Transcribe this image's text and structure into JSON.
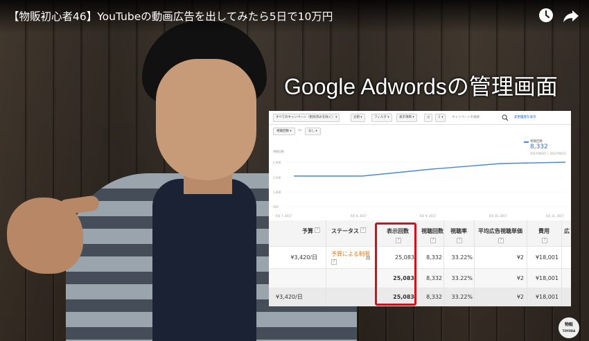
{
  "video": {
    "title": "【物販初心者46】YouTubeの動画広告を出してみたら5日で10万円",
    "caption": "Google Adwordsの管理画面"
  },
  "icons": {
    "watch_later": "clock-icon",
    "share": "share-arrow-icon"
  },
  "adwords": {
    "toolbar": {
      "campaign_filter": "すべてのキャンペーン（削除済みを除く） ▾",
      "segment": "分割 ▾",
      "filter": "フィルタ ▾",
      "columns": "表示項目 ▾",
      "search_placeholder": "キャンペーンを検索",
      "show_changes": "変更履歴を表示"
    },
    "segments": {
      "metric": "視聴回数 ▾",
      "vs": "vs",
      "none": "なし ▾"
    },
    "chart_legend": {
      "name": "視聴回数",
      "value": "8,332",
      "range": "2017/06/07 ~ 2017/06/11"
    },
    "table": {
      "headers": {
        "budget": "予算",
        "status": "ステータス",
        "impressions": "表示回数",
        "views": "視聴回数",
        "view_rate": "視聴率",
        "avg_cpv": "平均広告視聴単価",
        "cost": "費用",
        "extra": "広"
      },
      "rows": [
        {
          "budget": "¥3,420/日",
          "status": "予算による制限",
          "impressions": "25,083",
          "views": "8,332",
          "view_rate": "33.22%",
          "avg_cpv": "¥2",
          "cost": "¥18,001"
        },
        {
          "budget": "",
          "status": "",
          "impressions": "25,083",
          "views": "8,332",
          "view_rate": "33.22%",
          "avg_cpv": "¥2",
          "cost": "¥18,001"
        },
        {
          "budget": "¥3,420/日",
          "status": "",
          "impressions": "25,083",
          "views": "8,332",
          "view_rate": "33.22%",
          "avg_cpv": "¥2",
          "cost": "¥18,001"
        }
      ]
    },
    "colors": {
      "highlight_border": "#c8141c",
      "status_limited": "#e07b17",
      "chart_line": "#4a86d6"
    }
  },
  "watermark": {
    "line1": "物販",
    "line2": "TOYODA"
  }
}
